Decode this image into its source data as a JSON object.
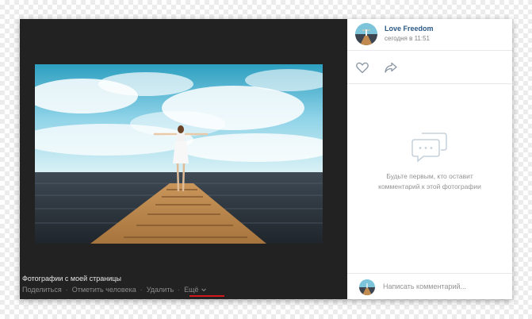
{
  "viewer": {
    "caption_title": "Фотографии с моей страницы",
    "actions": {
      "share": "Поделиться",
      "tag_person": "Отметить человека",
      "delete": "Удалить",
      "more": "Ещё"
    },
    "photo_icon": "woman-on-pier-photo"
  },
  "post": {
    "author": "Love Freedom",
    "time": "сегодня в 11:51",
    "avatar_icon": "avatar-icon"
  },
  "reactions": {
    "like_icon": "heart-icon",
    "share_icon": "share-icon"
  },
  "comments": {
    "empty_line1": "Будьте первым, кто оставит",
    "empty_line2": "комментарий к этой фотографии",
    "empty_icon": "comments-icon"
  },
  "composer": {
    "placeholder": "Написать комментарий..."
  },
  "colors": {
    "viewer_bg": "#222222",
    "link": "#2a5885",
    "highlight": "#d31a1a"
  }
}
